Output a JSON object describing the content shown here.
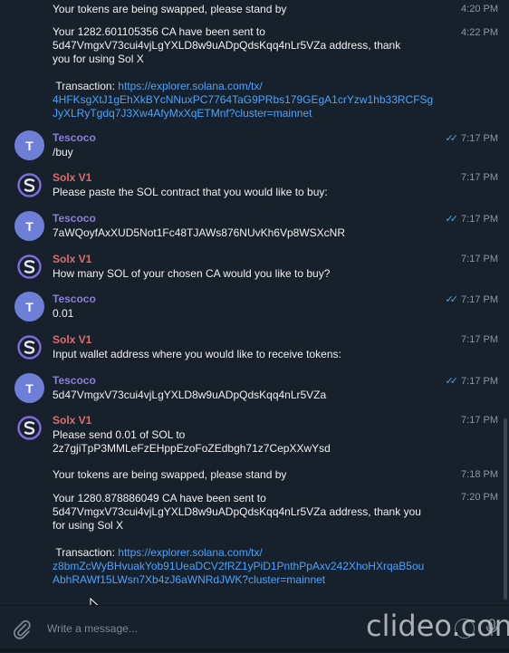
{
  "messages": [
    {
      "id": "m1",
      "sender": "solx",
      "show_header": false,
      "lines": [
        "Your tokens are being swapped, please stand by"
      ],
      "time": "4:20 PM"
    },
    {
      "id": "m2",
      "sender": "solx",
      "show_header": false,
      "lines": [
        "Your 1282.601105356 CA have been sent to",
        "5d47VmgxV73cui4vjLgYXLD8w9uADpQdsKqq4nLr5VZa address, thank",
        "you for using Sol X"
      ],
      "time": "4:22 PM",
      "transaction_label": "Transaction:",
      "transaction_link": [
        "https://explorer.solana.com/tx/",
        "4HFKsgXtJ1gEhXkBYcNNuxPC7764TaG9PRbs179GEgA1crYzw1hb33RCFSg",
        "JyXLRyTgdq7J3Xw4AfyMxXqETMnf?cluster=mainnet"
      ]
    },
    {
      "id": "m3",
      "sender": "tescoco",
      "name": "Tescoco",
      "avatar_letter": "T",
      "lines": [
        "/buy"
      ],
      "time": "7:17 PM",
      "read": true
    },
    {
      "id": "m4",
      "sender": "solx",
      "name": "Solx V1",
      "lines": [
        "Please paste the SOL contract that you would like to buy:"
      ],
      "time": "7:17 PM"
    },
    {
      "id": "m5",
      "sender": "tescoco",
      "name": "Tescoco",
      "avatar_letter": "T",
      "lines": [
        "7aWQoyfAxXUD5Not1Fc48TJAWs876NUvKh6Vp8WSXcNR"
      ],
      "time": "7:17 PM",
      "read": true
    },
    {
      "id": "m6",
      "sender": "solx",
      "name": "Solx V1",
      "lines": [
        "How many SOL of your chosen CA would you like to buy?"
      ],
      "time": "7:17 PM"
    },
    {
      "id": "m7",
      "sender": "tescoco",
      "name": "Tescoco",
      "avatar_letter": "T",
      "lines": [
        "0.01"
      ],
      "time": "7:17 PM",
      "read": true
    },
    {
      "id": "m8",
      "sender": "solx",
      "name": "Solx V1",
      "lines": [
        "Input wallet address where you would like to receive tokens:"
      ],
      "time": "7:17 PM"
    },
    {
      "id": "m9",
      "sender": "tescoco",
      "name": "Tescoco",
      "avatar_letter": "T",
      "lines": [
        "5d47VmgxV73cui4vjLgYXLD8w9uADpQdsKqq4nLr5VZa"
      ],
      "time": "7:17 PM",
      "read": true
    },
    {
      "id": "m10",
      "sender": "solx",
      "name": "Solx V1",
      "lines": [
        "Please send 0.01 of SOL to",
        "2z7gjiTpP3MMLeFzEHppEzoFoZEdbgh71z7CepXXwYsd"
      ],
      "time": "7:17 PM"
    },
    {
      "id": "m11",
      "sender": "solx",
      "show_header": false,
      "lines": [
        "Your tokens are being swapped, please stand by"
      ],
      "time": "7:18 PM"
    },
    {
      "id": "m12",
      "sender": "solx",
      "show_header": false,
      "lines": [
        "Your 1280.878886049 CA have been sent to",
        "5d47VmgxV73cui4vjLgYXLD8w9uADpQdsKqq4nLr5VZa address, thank you",
        "for using Sol X"
      ],
      "time": "7:20 PM",
      "transaction_label": "Transaction:",
      "transaction_link": [
        "https://explorer.solana.com/tx/",
        "z8bmZcWyBHvuakYob91UeaDCV2fRZ1yPiD1PnthPpAxv242XhoHXrqaB5ou",
        "AbhRAWf15LWsn7Xb4zJ6aWNRdJWK?cluster=mainnet"
      ]
    }
  ],
  "composer": {
    "placeholder": "Write a message..."
  },
  "watermark": "clideo.com",
  "icons": {
    "attach": "paperclip-icon",
    "emoji": "emoji-icon",
    "mic": "microphone-icon",
    "read": "double-check-icon"
  },
  "colors": {
    "background": "#17212b",
    "link": "#4aa3ff",
    "tescoco_name": "#8b7fd8",
    "solx_name": "#e06b6b",
    "tescoco_avatar": "#6e7fd8"
  }
}
